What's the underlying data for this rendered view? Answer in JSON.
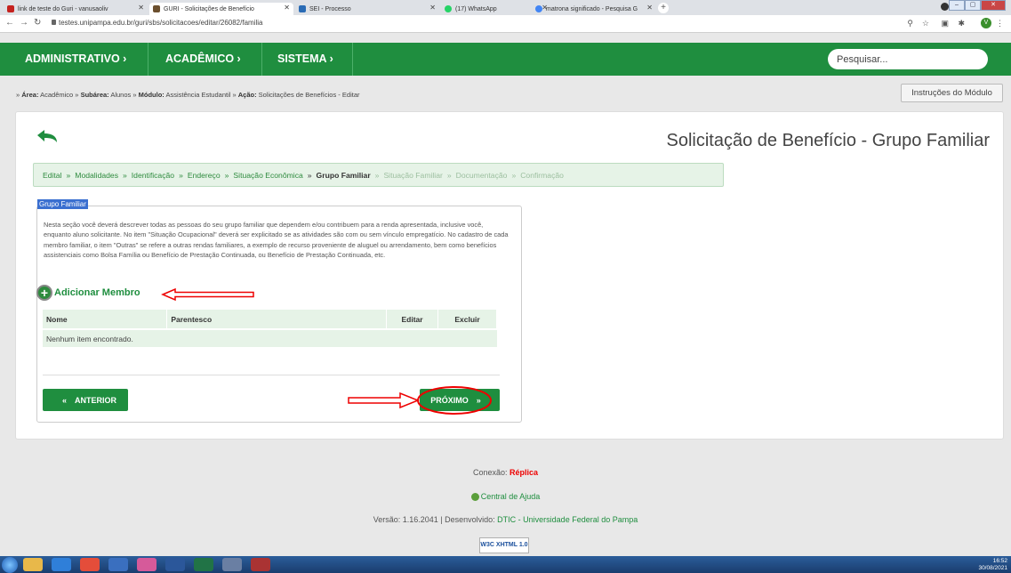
{
  "browser": {
    "tabs": [
      {
        "label": "link de teste do Guri - vanusaoliv",
        "favicon_color": "#c5221f"
      },
      {
        "label": "GURI - Solicitações de Benefício",
        "favicon_color": "#6b4f2e"
      },
      {
        "label": "SEI - Processo",
        "favicon_color": "#2a6bb5"
      },
      {
        "label": "(17) WhatsApp",
        "favicon_color": "#25d366"
      },
      {
        "label": "matrona significado - Pesquisa G",
        "favicon_color": "#4285f4"
      }
    ],
    "url": "testes.unipampa.edu.br/guri/sbs/solicitacoes/editar/26082/familia",
    "profile_initial": "V"
  },
  "nav": {
    "menus": [
      "ADMINISTRATIVO ›",
      "ACADÊMICO ›",
      "SISTEMA ›"
    ],
    "search_placeholder": "Pesquisar..."
  },
  "breadcrumb": {
    "prefix": "» ",
    "area_label": "Área:",
    "area": " Acadêmico » ",
    "subarea_label": "Subárea:",
    "subarea": " Alunos » ",
    "modulo_label": "Módulo:",
    "modulo": " Assistência Estudantil » ",
    "acao_label": "Ação:",
    "acao": " Solicitações de Benefícios - Editar"
  },
  "instructions_button": "Instruções do Módulo",
  "page_title": "Solicitação de Benefício - Grupo Familiar",
  "steps": [
    {
      "label": "Edital",
      "state": "done"
    },
    {
      "label": "Modalidades",
      "state": "done"
    },
    {
      "label": "Identificação",
      "state": "done"
    },
    {
      "label": "Endereço",
      "state": "done"
    },
    {
      "label": "Situação Econômica",
      "state": "done"
    },
    {
      "label": "Grupo Familiar",
      "state": "current"
    },
    {
      "label": "Situação Familiar",
      "state": "future"
    },
    {
      "label": "Documentação",
      "state": "future"
    },
    {
      "label": "Confirmação",
      "state": "future"
    }
  ],
  "section": {
    "legend": "Grupo Familiar",
    "description": "Nesta seção você deverá descrever todas as pessoas do seu grupo familiar que dependem e/ou contribuem para a renda apresentada, inclusive você, enquanto aluno solicitante. No item \"Situação Ocupacional\" deverá ser explicitado se as atividades são com ou sem vínculo empregatício. No cadastro de cada membro familiar, o item \"Outras\" se refere a outras rendas familiares, a exemplo de recurso proveniente de aluguel ou arrendamento, bem como benefícios assistenciais como Bolsa Família ou Benefício de Prestação Continuada, ou Benefício de Prestação Continuada, etc.",
    "add_member": "Adicionar Membro",
    "table": {
      "headers": [
        "Nome",
        "Parentesco",
        "Editar",
        "Excluir"
      ],
      "empty": "Nenhum item encontrado."
    },
    "prev_button": "ANTERIOR",
    "next_button": "PRÓXIMO"
  },
  "footer": {
    "conexao_label": "Conexão: ",
    "conexao_value": "Réplica",
    "help": "Central de Ajuda",
    "version_prefix": "Versão: 1.16.2041 | Desenvolvido: ",
    "developer": "DTIC - Universidade Federal do Pampa",
    "badge": "W3C XHTML 1.0"
  },
  "taskbar": {
    "time": "16:52",
    "date": "30/08/2021"
  }
}
